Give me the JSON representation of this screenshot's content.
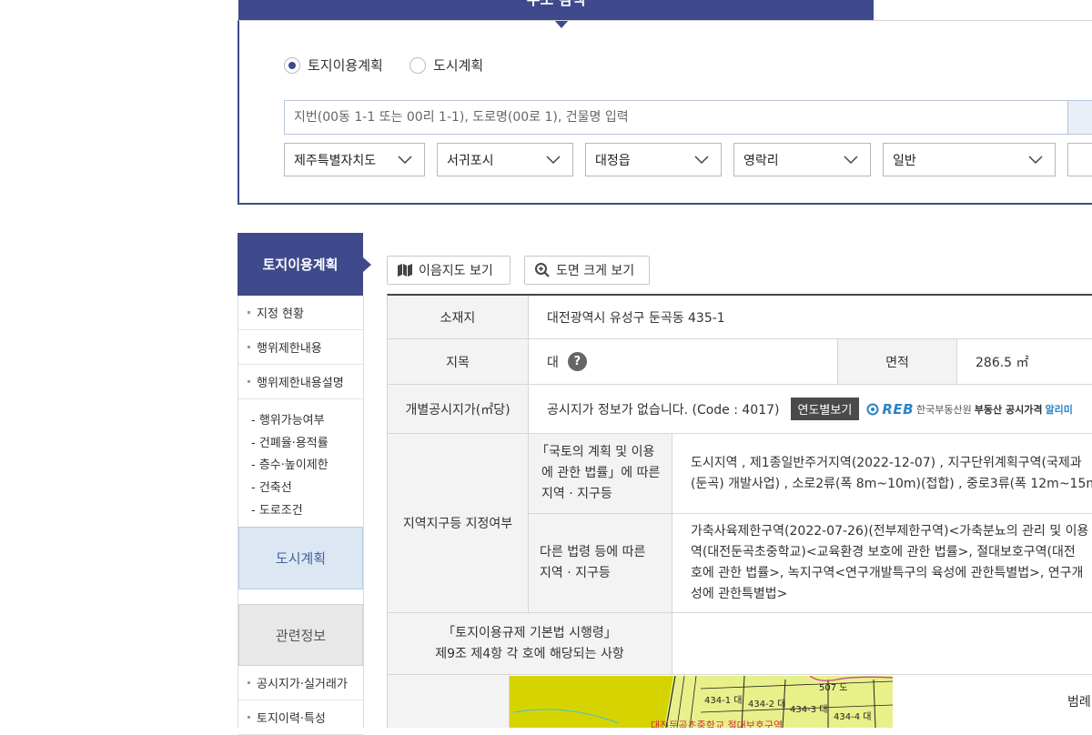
{
  "search": {
    "tab_label": "주소 검색",
    "radios": [
      {
        "label": "토지이용계획",
        "checked": true
      },
      {
        "label": "도시계획",
        "checked": false
      }
    ],
    "placeholder": "지번(00동 1-1 또는 00리 1-1), 도로명(00로 1), 건물명 입력",
    "selects": [
      "제주특별자치도",
      "서귀포시",
      "대정읍",
      "영락리",
      "일반"
    ]
  },
  "sidebar": {
    "header": "토지이용계획",
    "items": [
      "지정 현황",
      "행위제한내용",
      "행위제한내용설명"
    ],
    "sub_items": [
      "- 행위가능여부",
      "- 건폐율·용적률",
      "- 층수·높이제한",
      "- 건축선",
      "- 도로조건"
    ],
    "city_plan": "도시계획",
    "related": "관련정보",
    "related_items": [
      "공시지가·실거래가",
      "토지이력·특성"
    ]
  },
  "toolbar": {
    "map_view": "이음지도 보기",
    "zoom_view": "도면 크게 보기"
  },
  "table": {
    "location_label": "소재지",
    "location_value": "대전광역시 유성구 둔곡동 435-1",
    "jimok_label": "지목",
    "jimok_value": "대",
    "jimok_help": "?",
    "area_label": "면적",
    "area_value": "286.5 ㎡",
    "price_label": "개별공시지가(㎡당)",
    "price_value": "공시지가 정보가 없습니다. (Code : 4017)",
    "yearly_button": "연도별보기",
    "reb_logo": "REB",
    "reb_name": "한국부동산원",
    "reb_service": "부동산 공시가격",
    "reb_alimi": "알리미",
    "zone_label": "지역지구등 지정여부",
    "national_law_label": [
      "「국토의 계획 및 이용",
      "에 관한 법률」에 따른",
      "지역 · 지구등"
    ],
    "national_law_value": [
      "도시지역 , 제1종일반주거지역(2022-12-07) , 지구단위계획구역(국제과",
      "(둔곡) 개발사업) , 소로2류(폭 8m~10m)(접합) , 중로3류(폭 12m~15m"
    ],
    "other_law_label": [
      "다른 법령 등에 따른",
      "지역 · 지구등"
    ],
    "other_law_value": [
      "가축사육제한구역(2022-07-26)(전부제한구역)<가축분뇨의 관리 및 이용",
      "역(대전둔곡초중학교)<교육환경 보호에 관한 법률>, 절대보호구역(대전",
      "호에 관한 법률>, 녹지구역<연구개발특구의 육성에 관한특별법>, 연구개",
      "성에 관한특별법>"
    ],
    "regulation_label": [
      "「토지이용규제 기본법 시행령」",
      "제9조 제4항 각 호에 해당되는 사항"
    ],
    "legend_label": "범례"
  },
  "map": {
    "parcels": [
      "434-1 대",
      "434-2 대",
      "434-3 대",
      "434-4 대",
      "507 도"
    ],
    "zone_text": "대전둔곡초중학교 절대보호구역"
  },
  "colors": {
    "primary": "#3e4a8b",
    "city_plan_bg": "#dde7f3",
    "map_land": "#e8f08a",
    "map_green": "#d6d400"
  }
}
